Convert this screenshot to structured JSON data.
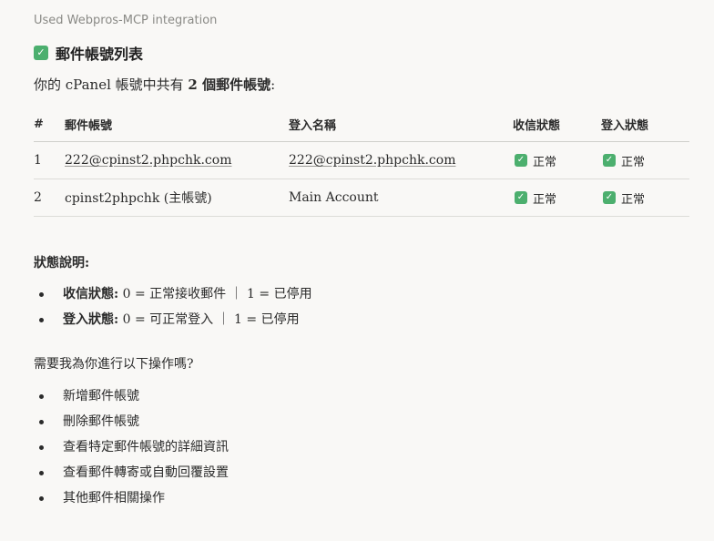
{
  "tool_note": "Used Webpros-MCP integration",
  "heading": {
    "icon": "check-box-icon",
    "text": "郵件帳號列表"
  },
  "intro": {
    "prefix": "你的 cPanel 帳號中共有 ",
    "count_bold": "2 個郵件帳號",
    "suffix": ":"
  },
  "table": {
    "headers": [
      "#",
      "郵件帳號",
      "登入名稱",
      "收信狀態",
      "登入狀態"
    ],
    "rows": [
      {
        "num": "1",
        "account": "222@cpinst2.phpchk.com",
        "login": "222@cpinst2.phpchk.com",
        "receive_status": "正常",
        "login_status": "正常"
      },
      {
        "num": "2",
        "account": "cpinst2phpchk (主帳號)",
        "login": "Main Account",
        "receive_status": "正常",
        "login_status": "正常"
      }
    ]
  },
  "legend": {
    "title": "狀態說明:",
    "items": [
      {
        "label": "收信狀態:",
        "text": " 0 = 正常接收郵件 ｜ 1 = 已停用"
      },
      {
        "label": "登入狀態:",
        "text": " 0 = 可正常登入 ｜ 1 = 已停用"
      }
    ]
  },
  "question": "需要我為你進行以下操作嗎?",
  "actions": [
    "新增郵件帳號",
    "刪除郵件帳號",
    "查看特定郵件帳號的詳細資訊",
    "查看郵件轉寄或自動回覆設置",
    "其他郵件相關操作"
  ],
  "colors": {
    "background": "#f9f8f6",
    "check_green": "#4caf6e",
    "text": "#2b2b2b",
    "muted": "#8a8a86"
  }
}
